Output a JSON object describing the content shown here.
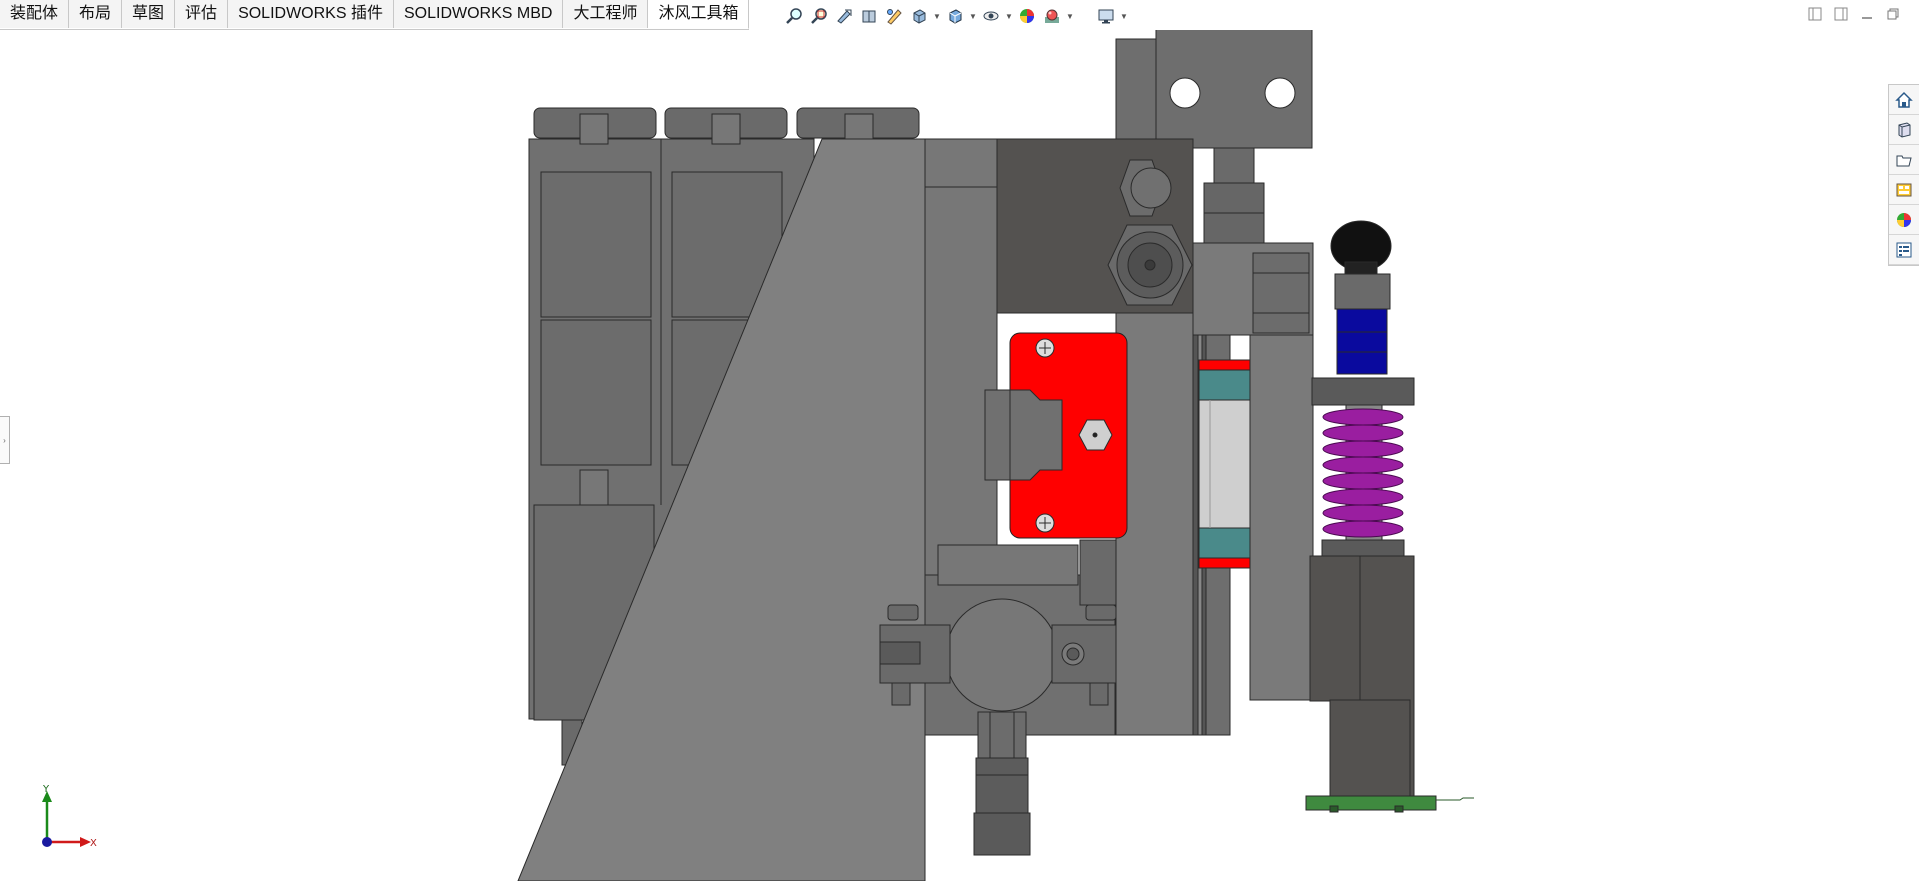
{
  "tabs": [
    {
      "label": "装配体",
      "active": false
    },
    {
      "label": "布局",
      "active": false
    },
    {
      "label": "草图",
      "active": false
    },
    {
      "label": "评估",
      "active": false
    },
    {
      "label": "SOLIDWORKS 插件",
      "active": false
    },
    {
      "label": "SOLIDWORKS MBD",
      "active": false
    },
    {
      "label": "大工程师",
      "active": false
    },
    {
      "label": "沐风工具箱",
      "active": true
    }
  ],
  "heads_up_toolbar": [
    {
      "icon": "zoom-to-fit-icon"
    },
    {
      "icon": "zoom-to-area-icon"
    },
    {
      "icon": "previous-view-icon"
    },
    {
      "icon": "section-view-icon"
    },
    {
      "icon": "dynamic-annotation-icon"
    },
    {
      "icon": "view-orientation-icon",
      "dropdown": true
    },
    {
      "icon": "display-style-icon",
      "dropdown": true
    },
    {
      "icon": "hide-show-items-icon",
      "dropdown": true
    },
    {
      "icon": "edit-appearance-icon"
    },
    {
      "icon": "apply-scene-icon",
      "dropdown": true
    },
    {
      "icon": "view-settings-icon",
      "dropdown": true
    }
  ],
  "window_controls": [
    "tile-left-icon",
    "tile-right-icon",
    "minimize-icon",
    "restore-icon"
  ],
  "task_pane": [
    "home-icon",
    "design-library-icon",
    "file-explorer-icon",
    "view-palette-icon",
    "appearances-icon",
    "custom-properties-icon"
  ],
  "triad": {
    "x_label": "X",
    "y_label": "Y"
  },
  "colors": {
    "part_gray": "#7a7a7a",
    "dark_block": "#545250",
    "slider_red": "#ff0000",
    "rail_teal": "#4a8a8a",
    "spring_purple": "#9a1ea0",
    "knob_black": "#111111",
    "nut_blue": "#0a0a9e",
    "pcb_green": "#3f8a3f"
  }
}
